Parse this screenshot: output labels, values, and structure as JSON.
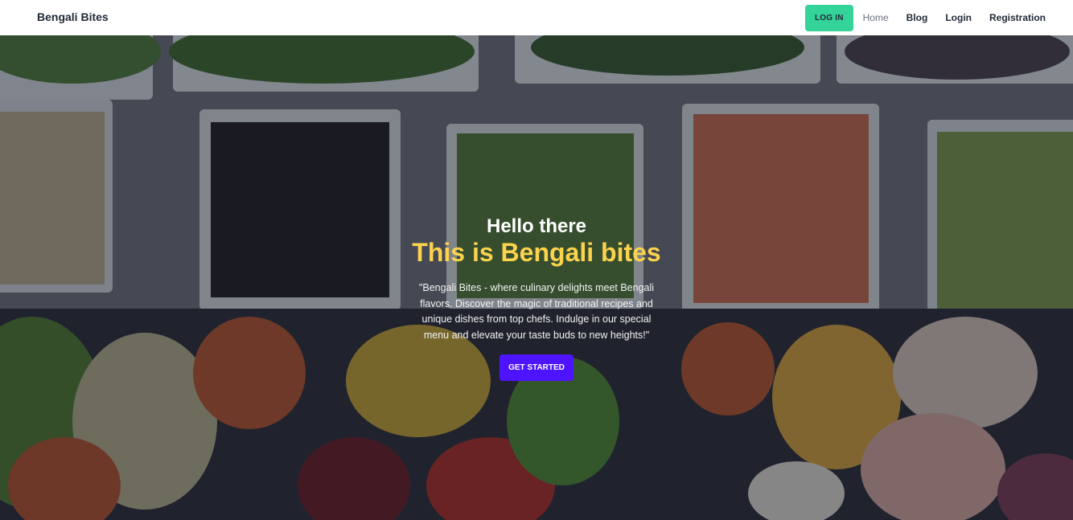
{
  "navbar": {
    "brand": "Bengali Bites",
    "login_button": "LOG IN",
    "links": [
      "Home",
      "Blog",
      "Login",
      "Registration"
    ]
  },
  "hero": {
    "greeting": "Hello there",
    "headline": "This is Bengali bites",
    "description": "\"Bengali Bites - where culinary delights meet Bengali flavors. Discover the magic of traditional recipes and unique dishes from top chefs. Indulge in our special menu and elevate your taste buds to new heights!\"",
    "cta": "GET STARTED"
  },
  "colors": {
    "login_button": "#34d399",
    "headline": "#fcd34d",
    "cta": "#4f14ff"
  }
}
